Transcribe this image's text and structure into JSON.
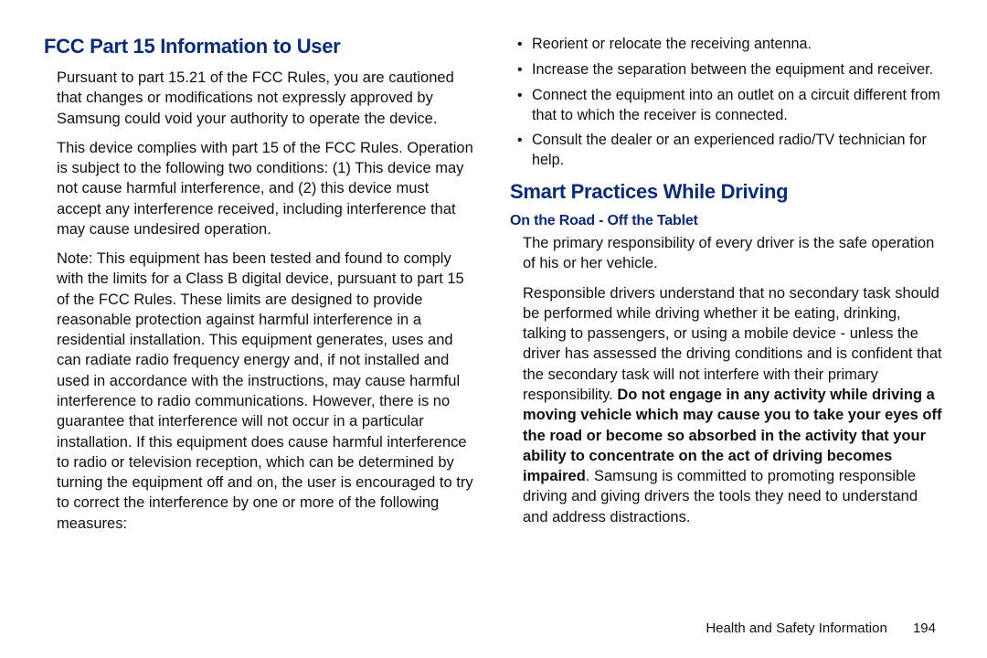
{
  "left": {
    "heading": "FCC Part 15 Information to User",
    "p1": "Pursuant to part 15.21 of the FCC Rules, you are cautioned that changes or modifications not expressly approved by Samsung could void your authority to operate the device.",
    "p2": "This device complies with part 15 of the FCC Rules. Operation is subject to the following two conditions: (1) This device may not cause harmful interference, and (2) this device must accept any interference received, including interference that may cause undesired operation.",
    "p3": "Note: This equipment has been tested and found to comply with the limits for a Class B digital device, pursuant to part 15 of the FCC Rules. These limits are designed to provide reasonable protection against harmful interference in a residential installation. This equipment generates, uses and can radiate radio frequency energy and, if not installed and used in accordance with the instructions, may cause harmful interference to radio communications. However, there is no guarantee that interference will not occur in a particular installation. If this equipment does cause harmful interference to radio or television reception, which can be determined by turning the equipment off and on, the user is encouraged to try to correct the interference by one or more of the following measures:"
  },
  "right": {
    "bullets": [
      "Reorient or relocate the receiving antenna.",
      "Increase the separation between the equipment and receiver.",
      "Connect the equipment into an outlet on a circuit different from that to which the receiver is connected.",
      "Consult the dealer or an experienced radio/TV technician for help."
    ],
    "heading2": "Smart Practices While Driving",
    "subheading": "On the Road - Off the Tablet",
    "p1": "The primary responsibility of every driver is the safe operation of his or her vehicle.",
    "p2_a": "Responsible drivers understand that no secondary task should be performed while driving whether it be eating, drinking, talking to passengers, or using a mobile device - unless the driver has assessed the driving conditions and is confident that the secondary task will not interfere with their primary responsibility. ",
    "p2_bold": "Do not engage in any activity while driving a moving vehicle which may cause you to take your eyes off the road or become so absorbed in the activity that your ability to concentrate on the act of driving becomes impaired",
    "p2_b": ". Samsung is committed to promoting responsible driving and giving drivers the tools they need to understand and address distractions."
  },
  "footer": {
    "label": "Health and Safety Information",
    "page": "194"
  }
}
